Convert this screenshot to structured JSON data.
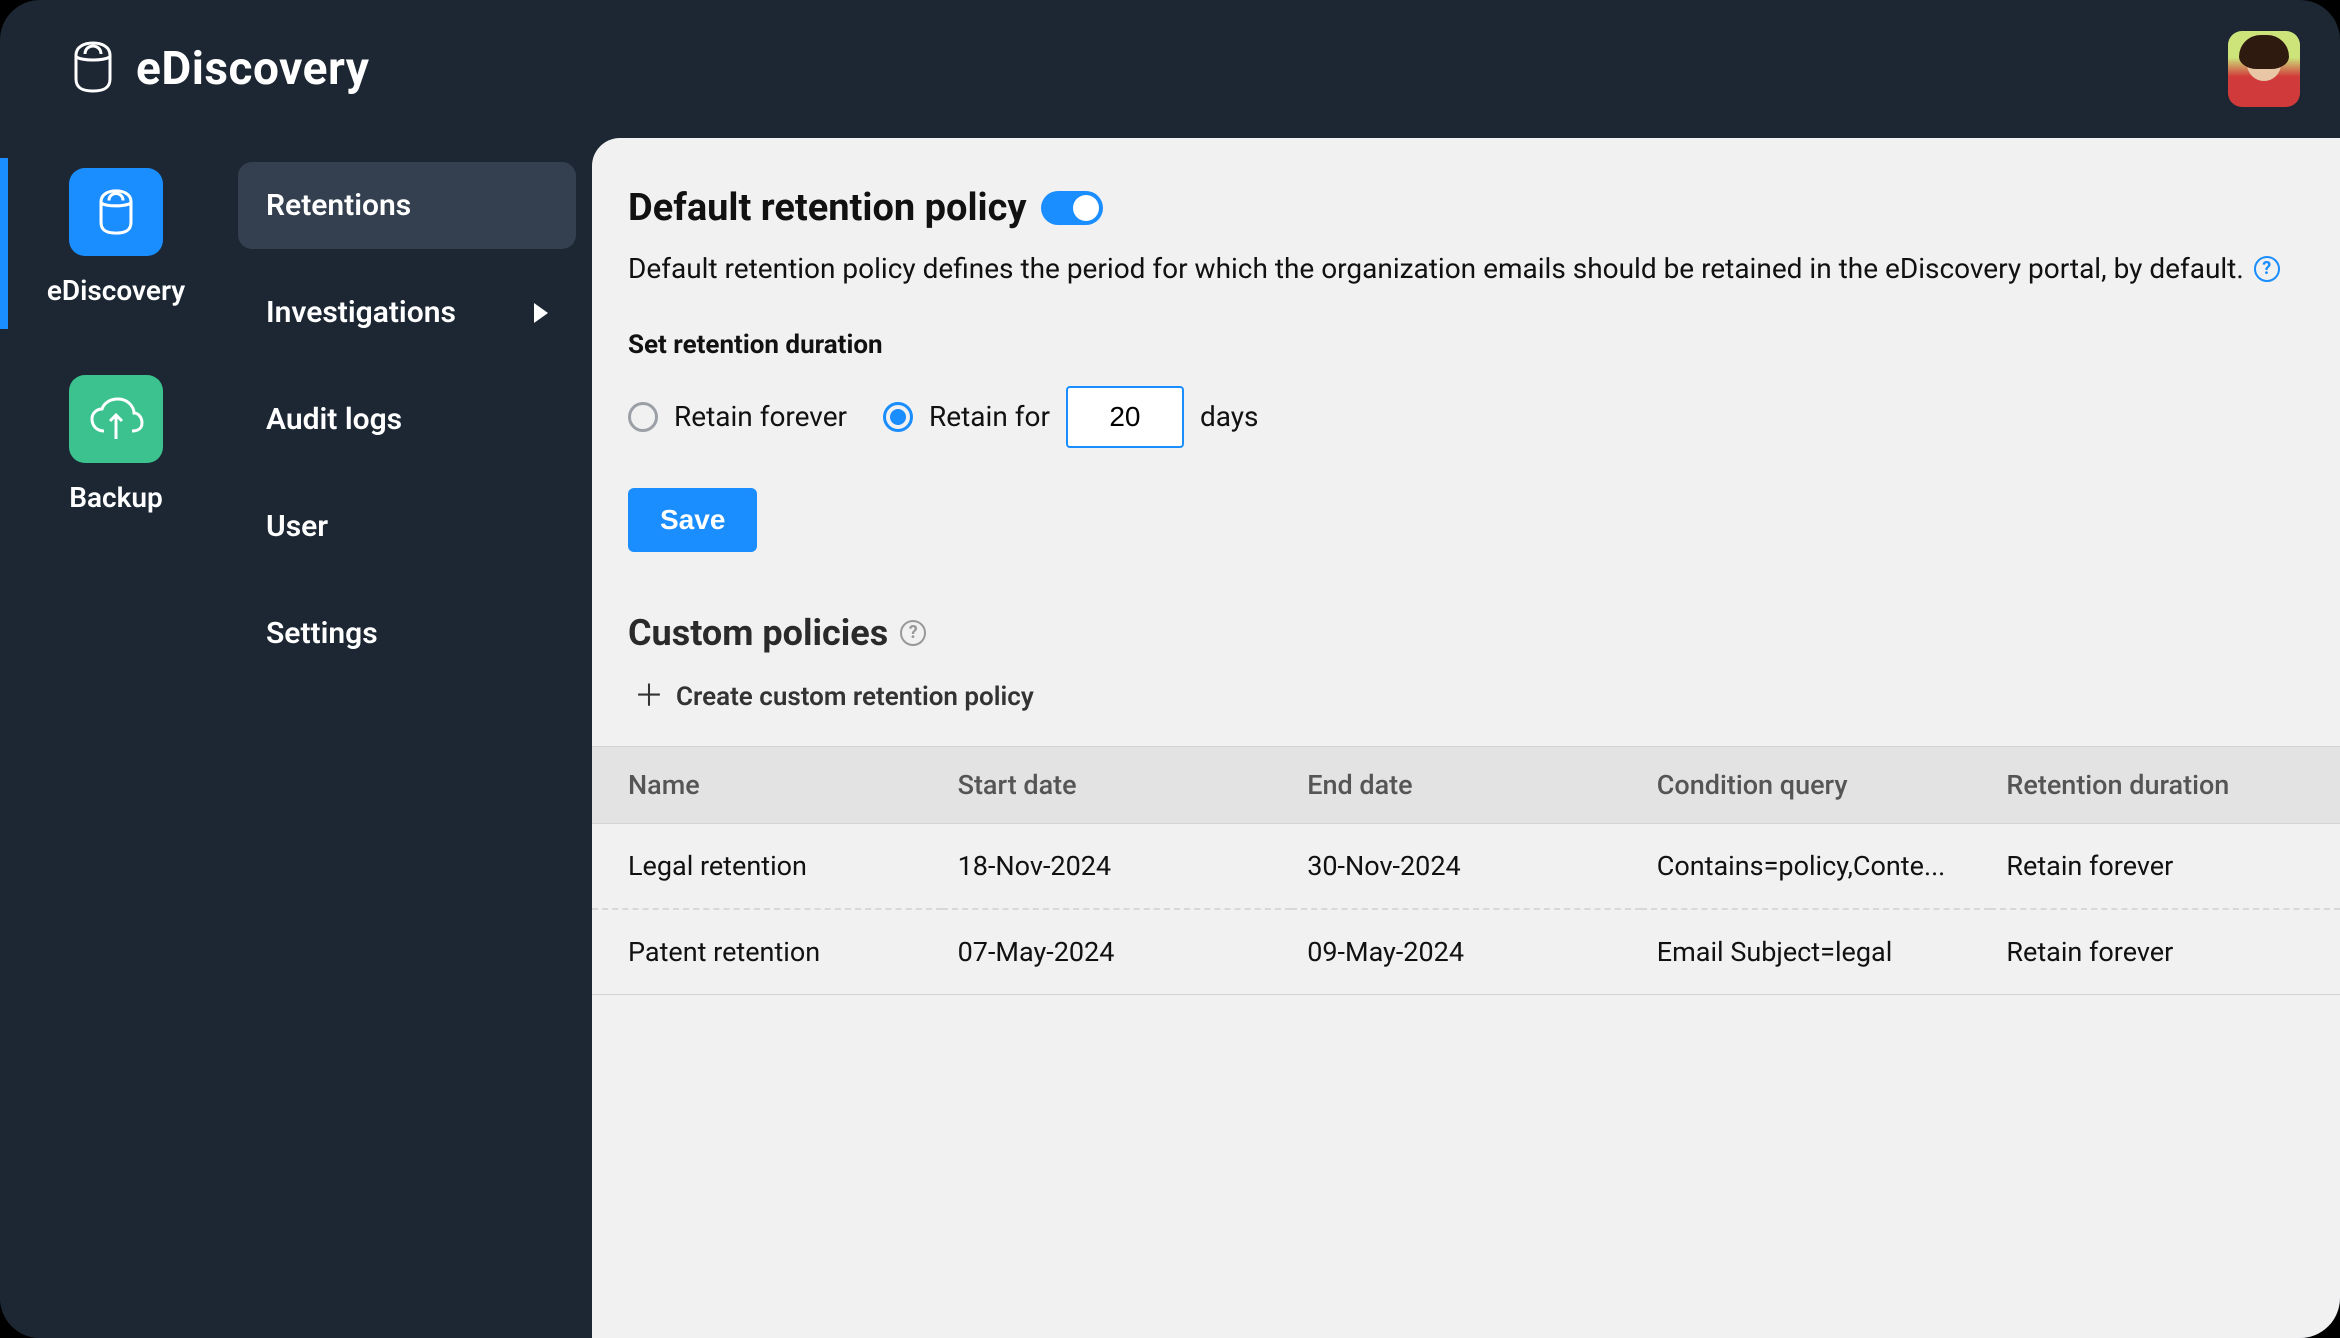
{
  "app": {
    "title": "eDiscovery"
  },
  "rail": {
    "items": [
      {
        "label": "eDiscovery"
      },
      {
        "label": "Backup"
      }
    ]
  },
  "subnav": {
    "items": [
      {
        "label": "Retentions"
      },
      {
        "label": "Investigations"
      },
      {
        "label": "Audit logs"
      },
      {
        "label": "User"
      },
      {
        "label": "Settings"
      }
    ]
  },
  "retention": {
    "title": "Default retention policy",
    "description": "Default retention policy defines the period for which the organization emails should be retained in the eDiscovery portal, by default.",
    "set_duration_label": "Set retention duration",
    "option_forever": "Retain forever",
    "option_for": "Retain for",
    "days_value": "20",
    "days_unit": "days",
    "save_label": "Save"
  },
  "custom": {
    "title": "Custom policies",
    "create_label": "Create custom retention policy",
    "columns": {
      "name": "Name",
      "start": "Start date",
      "end": "End date",
      "condition": "Condition query",
      "duration": "Retention duration"
    },
    "rows": [
      {
        "name": "Legal retention",
        "start": "18-Nov-2024",
        "end": "30-Nov-2024",
        "condition": "Contains=policy,Conte...",
        "duration": "Retain forever"
      },
      {
        "name": "Patent retention",
        "start": "07-May-2024",
        "end": "09-May-2024",
        "condition": "Email Subject=legal",
        "duration": "Retain forever"
      }
    ]
  }
}
